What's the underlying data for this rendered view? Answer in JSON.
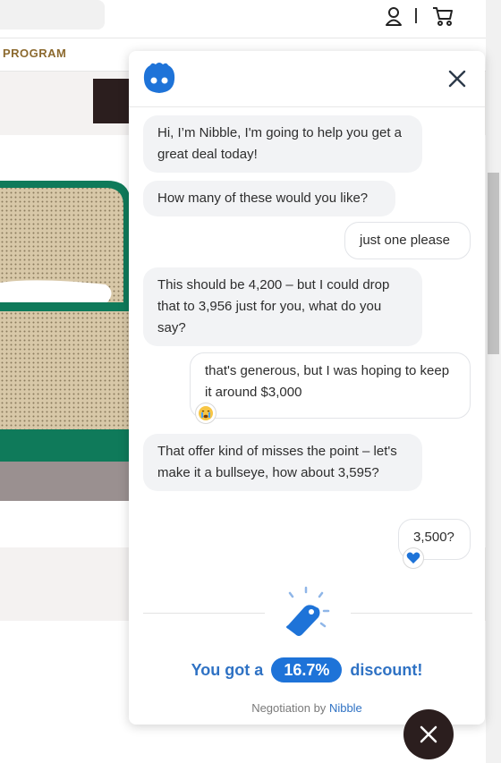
{
  "page": {
    "nav": {
      "program_label": "PROGRAM"
    },
    "header_icons": [
      "account-icon",
      "cart-icon"
    ]
  },
  "chat": {
    "messages": [
      {
        "from": "bot",
        "text": "Hi, I’m Nibble, I'm going to help you get a great deal today!"
      },
      {
        "from": "bot",
        "text": "How many of these would you like?"
      },
      {
        "from": "user",
        "text": "just one please"
      },
      {
        "from": "bot",
        "text": "This should be 4,200 – but I could drop that to 3,956 just for you, what do you say?"
      },
      {
        "from": "user",
        "text": "that's generous, but I was hoping to keep it around $3,000",
        "reaction": "crying-face-emoji"
      },
      {
        "from": "bot",
        "text": "That offer kind of misses the point – let's make it a bullseye, how about 3,595?"
      },
      {
        "from": "user",
        "text": "3,500?",
        "reaction": "blue-heart-emoji"
      }
    ],
    "result": {
      "prefix": "You got a",
      "value": "16.7%",
      "suffix": "discount!"
    },
    "footer": {
      "prefix": "Negotiation by",
      "brand": "Nibble"
    }
  },
  "colors": {
    "accent": "#1e73d8",
    "accent_text": "#2f72c4",
    "bot_bubble": "#f2f3f5",
    "fab": "#2b1e1e",
    "nav_gold": "#8c6a2f"
  }
}
